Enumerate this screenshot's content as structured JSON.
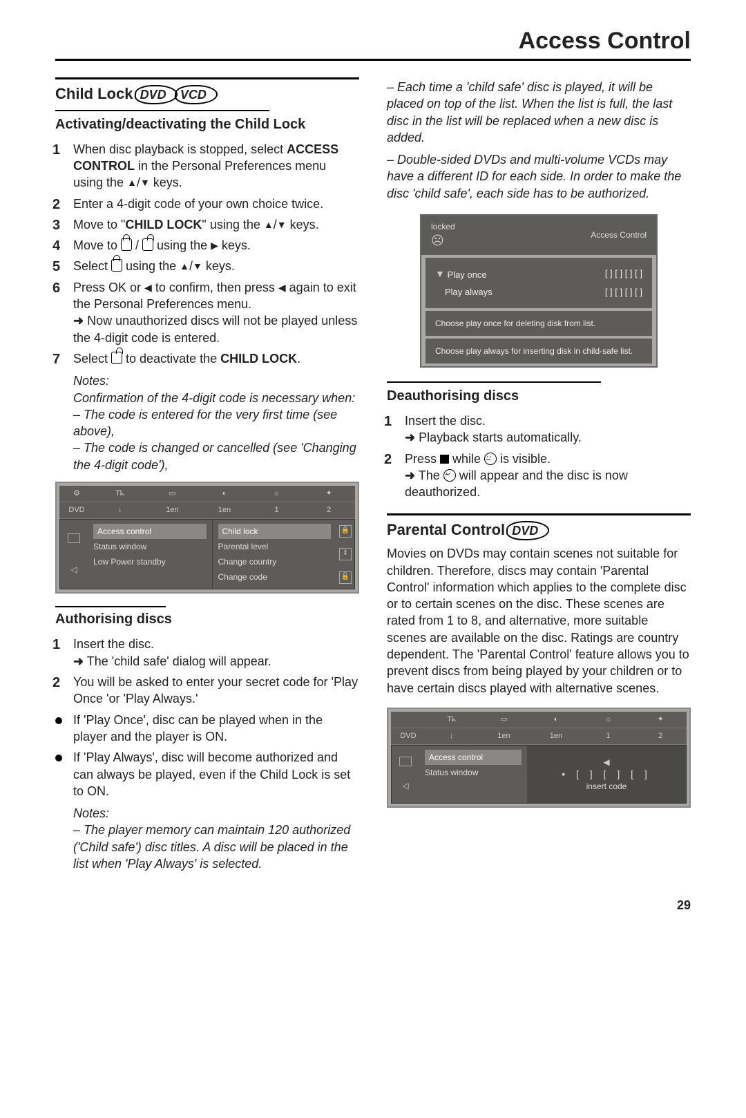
{
  "header": {
    "title": "Access Control"
  },
  "page_number": "29",
  "left": {
    "title_prefix": "Child Lock ",
    "badge1": "DVD",
    "badge2": "VCD",
    "sub1_title": "Activating/deactivating the Child Lock",
    "step1_a": "When disc playback is stopped, select ",
    "step1_b": "ACCESS CONTROL",
    "step1_c": " in the Personal Preferences menu using the ",
    "step1_d": " keys.",
    "step2": "Enter a 4-digit code of your own choice twice.",
    "step3_a": "Move to \"",
    "step3_b": "CHILD LOCK",
    "step3_c": "\" using the ",
    "step3_d": " keys.",
    "step4_a": "Move to ",
    "step4_b": " / ",
    "step4_c": " using the ",
    "step4_d": " keys.",
    "step5_a": "Select ",
    "step5_b": " using the ",
    "step5_c": " keys.",
    "step6_a": "Press OK or ",
    "step6_b": " to confirm, then press ",
    "step6_c": " again to exit the Personal Preferences menu.",
    "step6_note": " Now unauthorized discs will not be played unless the 4-digit code is entered.",
    "step7_a": "Select ",
    "step7_b": " to deactivate the ",
    "step7_c": "CHILD LOCK",
    "step7_d": ".",
    "notes_label": "Notes:",
    "notes_line1": "Confirmation of the 4-digit code is necessary when:",
    "notes_line2": "–   The code is entered for the very first time (see above),",
    "notes_line3": "–   The code is changed or cancelled (see 'Changing the 4-digit code'),",
    "ui1": {
      "tab_dvd": "DVD",
      "tab_1en_a": "1en",
      "tab_1en_b": "1en",
      "tab_1": "1",
      "tab_2": "2",
      "mid_items": [
        "Access control",
        "Status window",
        "Low Power standby"
      ],
      "right_items": [
        "Child lock",
        "Parental level",
        "Change country",
        "Change code"
      ]
    },
    "auth_title": "Authorising discs",
    "auth_step1_a": "Insert the disc.",
    "auth_step1_b": " The 'child safe' dialog will appear.",
    "auth_step2": "You will be asked to enter your secret code for 'Play Once 'or 'Play Always.'",
    "auth_bullet1": "If 'Play Once', disc can be played when in the player and the player is ON.",
    "auth_bullet2": "If 'Play Always', disc will become authorized and can always be played, even if the Child Lock is set to ON.",
    "auth_notes_label": "Notes:",
    "auth_notes_line": "–   The player memory can maintain 120 authorized ('Child safe') disc titles. A disc will be placed in the list when 'Play Always' is selected."
  },
  "right": {
    "cont_note1": "–   Each time a 'child safe' disc is played, it will be placed on top of the list. When the list is full, the last disc in the list will be replaced when a new disc is added.",
    "cont_note2": "–   Double-sided DVDs and multi-volume VCDs may have a different ID for each side. In order to make the disc 'child safe', each side has to be authorized.",
    "locked_panel": {
      "locked_label": "locked",
      "title": "Access Control",
      "row1_label": "Play once",
      "row1_slots": "[ ]  [ ]  [ ]  [ ]",
      "row2_label": "Play always",
      "row2_slots": "[ ]  [ ]  [ ]  [ ]",
      "hint1": "Choose play once for deleting disk from list.",
      "hint2": "Choose play always for inserting disk in child-safe list."
    },
    "deauth_title": "Deauthorising discs",
    "deauth_step1_a": "Insert the disc.",
    "deauth_step1_b": " Playback starts automatically.",
    "deauth_step2_a": "Press ",
    "deauth_step2_b": " while ",
    "deauth_step2_c": " is visible.",
    "deauth_step2_note_a": " The ",
    "deauth_step2_note_b": " will appear and the disc is now deauthorized.",
    "parental_title_prefix": "Parental Control ",
    "parental_badge": "DVD",
    "parental_body": "Movies on DVDs may contain scenes not suitable for children. Therefore, discs may contain 'Parental Control' information which applies to the complete disc or to certain scenes on the disc. These scenes are rated from 1 to 8, and alternative, more suitable scenes are available on the disc. Ratings are country dependent. The 'Parental Control' feature allows you to prevent discs from being played by your children or to have certain discs played with alternative scenes.",
    "ui2": {
      "tab_dvd": "DVD",
      "tab_1en_a": "1en",
      "tab_1en_b": "1en",
      "tab_1": "1",
      "tab_2": "2",
      "mid_items": [
        "Access control",
        "Status window"
      ],
      "code_slots": "•  [ ]  [ ]  [ ]",
      "insert_label": "insert code"
    }
  }
}
